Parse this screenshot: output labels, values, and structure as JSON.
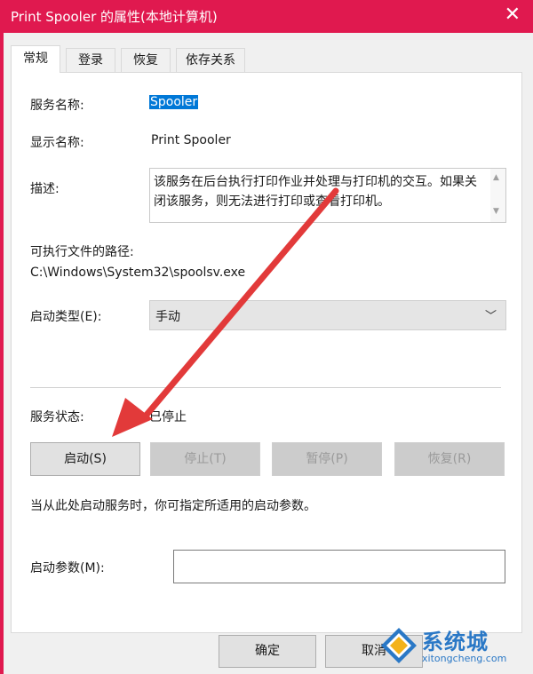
{
  "window": {
    "title": "Print Spooler 的属性(本地计算机)",
    "close_glyph": "✕"
  },
  "tabs": [
    {
      "label": "常规"
    },
    {
      "label": "登录"
    },
    {
      "label": "恢复"
    },
    {
      "label": "依存关系"
    }
  ],
  "general": {
    "service_name_label": "服务名称:",
    "service_name_value": "Spooler",
    "display_name_label": "显示名称:",
    "display_name_value": "Print Spooler",
    "description_label": "描述:",
    "description_value": "该服务在后台执行打印作业并处理与打印机的交互。如果关闭该服务，则无法进行打印或查看打印机。",
    "exe_path_label": "可执行文件的路径:",
    "exe_path_value": "C:\\Windows\\System32\\spoolsv.exe",
    "startup_type_label": "启动类型(E):",
    "startup_type_value": "手动",
    "status_label": "服务状态:",
    "status_value": "已停止",
    "buttons": {
      "start": "启动(S)",
      "stop": "停止(T)",
      "pause": "暂停(P)",
      "resume": "恢复(R)"
    },
    "hint": "当从此处启动服务时，你可指定所适用的启动参数。",
    "params_label": "启动参数(M):",
    "params_value": ""
  },
  "footer": {
    "ok": "确定",
    "cancel": "取消"
  },
  "watermark": {
    "brand": "系统城",
    "site": "xitongcheng.com"
  },
  "colors": {
    "titlebar": "#e0194f",
    "arrow": "#e23a3a",
    "selection": "#0078d7"
  },
  "icons": {
    "close": "close-icon",
    "chevron": "chevron-down-icon",
    "arrow": "annotation-arrow"
  }
}
